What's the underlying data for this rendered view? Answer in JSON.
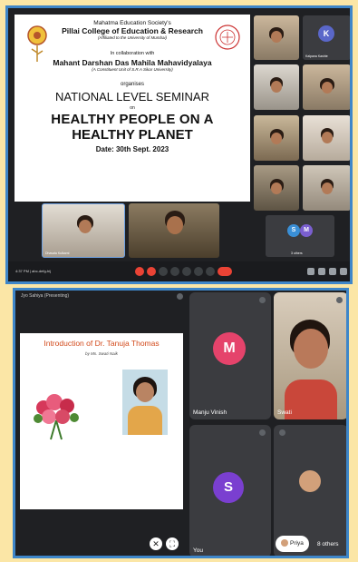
{
  "top": {
    "slide": {
      "line1": "Mahatma Education Society's",
      "line2": "Pillai College of Education & Research",
      "line3": "(Affiliated to the University of Mumbai)",
      "line4": "In collaboration with",
      "line5": "Mahant Darshan Das Mahila Mahavidyalaya",
      "line6": "(A Constituent Unit of S.R.A Sikar University)",
      "line7": "organises",
      "line8": "NATIONAL LEVEL SEMINAR",
      "line9": "on",
      "line10": "HEALTHY PEOPLE ON A",
      "line11": "HEALTHY PLANET",
      "line12": "Date: 30th Sept. 2023"
    },
    "tiles": {
      "k_letter": "K",
      "k_name": "Kalpana Kashte",
      "m_letter": "M",
      "s_letter": "S",
      "bottom_group_label": "3 others",
      "presenter_name": "Dhavala Kulkarni"
    },
    "control_time": "4:37 PM   |  abc-defg-hij"
  },
  "bottom": {
    "topline": "Jyo Sahiya (Presenting)",
    "slide": {
      "title": "Introduction of Dr. Tanuja Thomas",
      "subtitle": "by Ms. Swati Naik"
    },
    "tiles": {
      "m_letter": "M",
      "m_name": "Manju Vinish",
      "right_top_name": "Swati",
      "s_letter": "S",
      "you_label": "You",
      "priya_label": "Priya",
      "others_label": "8 others"
    }
  },
  "colors": {
    "background": "#fbe6a6",
    "frame": "#3e86c9",
    "avatar_k": "#5a67c9",
    "avatar_m": "#e5436b",
    "avatar_s": "#7a3fd0"
  }
}
